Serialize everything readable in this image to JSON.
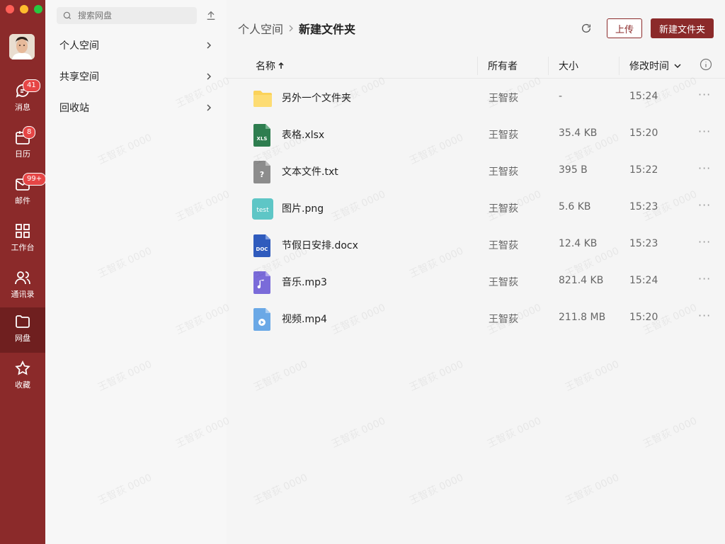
{
  "rail": {
    "items": [
      {
        "label": "消息",
        "badge": "41"
      },
      {
        "label": "日历",
        "badge": "8"
      },
      {
        "label": "邮件",
        "badge": "99+"
      },
      {
        "label": "工作台",
        "badge": ""
      },
      {
        "label": "通讯录",
        "badge": ""
      },
      {
        "label": "网盘",
        "badge": ""
      },
      {
        "label": "收藏",
        "badge": ""
      }
    ]
  },
  "nav": {
    "search_placeholder": "搜索网盘",
    "items": [
      {
        "label": "个人空间"
      },
      {
        "label": "共享空间"
      },
      {
        "label": "回收站"
      }
    ]
  },
  "main": {
    "breadcrumb": {
      "parent": "个人空间",
      "current": "新建文件夹"
    },
    "upload_label": "上传",
    "new_folder_label": "新建文件夹",
    "columns": {
      "name": "名称",
      "owner": "所有者",
      "size": "大小",
      "modified": "修改时间"
    },
    "files": [
      {
        "name": "另外一个文件夹",
        "owner": "王智荻",
        "size": "-",
        "time": "15:24",
        "icon": "folder-icon"
      },
      {
        "name": "表格.xlsx",
        "owner": "王智荻",
        "size": "35.4 KB",
        "time": "15:20",
        "icon": "xls-file-icon"
      },
      {
        "name": "文本文件.txt",
        "owner": "王智荻",
        "size": "395 B",
        "time": "15:22",
        "icon": "unknown-file-icon"
      },
      {
        "name": "图片.png",
        "owner": "王智荻",
        "size": "5.6 KB",
        "time": "15:23",
        "icon": "image-file-icon"
      },
      {
        "name": "节假日安排.docx",
        "owner": "王智荻",
        "size": "12.4 KB",
        "time": "15:23",
        "icon": "doc-file-icon"
      },
      {
        "name": "音乐.mp3",
        "owner": "王智荻",
        "size": "821.4 KB",
        "time": "15:24",
        "icon": "audio-file-icon"
      },
      {
        "name": "视频.mp4",
        "owner": "王智荻",
        "size": "211.8 MB",
        "time": "15:20",
        "icon": "video-file-icon"
      }
    ]
  },
  "icons_text": {
    "xls": "XLS",
    "doc": "DOC",
    "test": "test",
    "q": "?"
  },
  "colors": {
    "brand": "#8b2a2a",
    "rail_active": "#6f1f1f",
    "badge": "#e64545"
  },
  "watermark": "王智荻 0000"
}
